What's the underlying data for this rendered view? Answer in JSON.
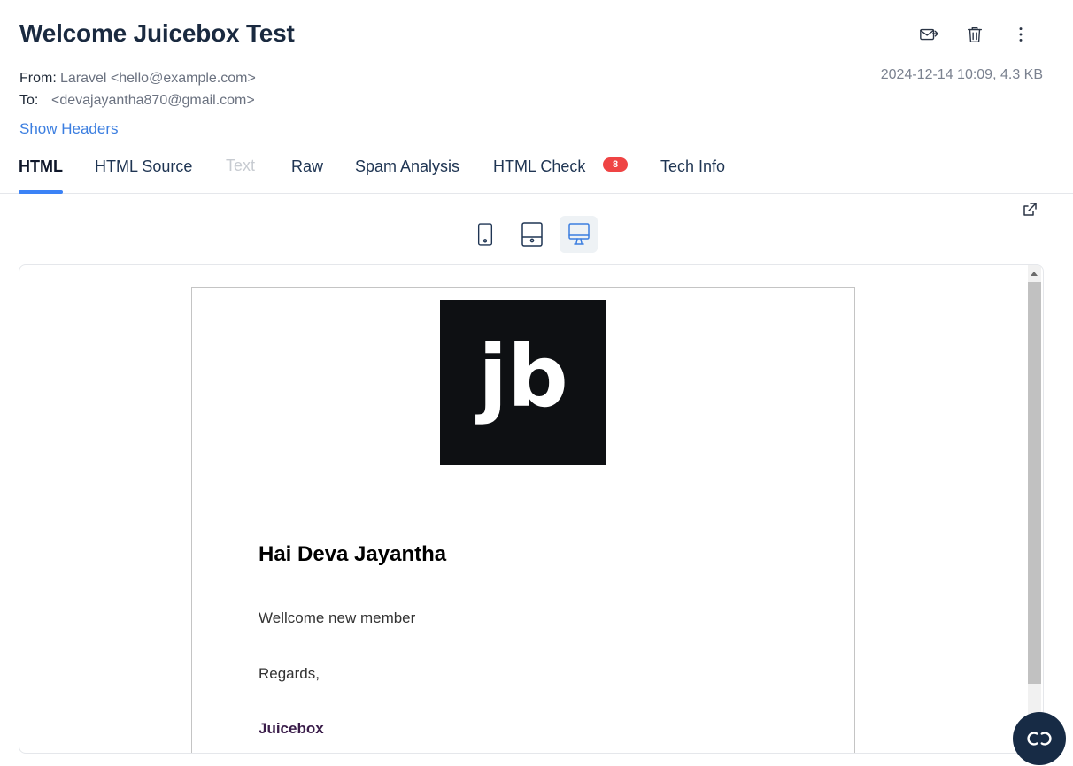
{
  "email": {
    "subject": "Welcome Juicebox Test",
    "from_label": "From:",
    "from_value": "Laravel <hello@example.com>",
    "to_label": "To:",
    "to_value": "<devajayantha870@gmail.com>",
    "date_size": "2024-12-14 10:09, 4.3 KB",
    "show_headers": "Show Headers"
  },
  "actions": {
    "icons": [
      "forward-mail-icon",
      "trash-icon",
      "more-vertical-icon"
    ]
  },
  "tabs": [
    {
      "label": "HTML",
      "state": "active"
    },
    {
      "label": "HTML Source",
      "state": "normal"
    },
    {
      "label": "Text",
      "state": "disabled"
    },
    {
      "label": "Raw",
      "state": "normal"
    },
    {
      "label": "Spam Analysis",
      "state": "normal"
    },
    {
      "label": "HTML Check",
      "state": "normal",
      "badge": "8"
    },
    {
      "label": "Tech Info",
      "state": "normal"
    }
  ],
  "device_switch": {
    "options": [
      "mobile",
      "tablet",
      "desktop"
    ],
    "selected": "desktop"
  },
  "preview": {
    "logo_text": "jb",
    "greeting": "Hai Deva Jayantha",
    "line1": "Wellcome new member",
    "line2": "Regards,",
    "signoff": "Juicebox"
  },
  "colors": {
    "accent": "#3b82f6",
    "badge": "#ef4444",
    "fab": "#172b45",
    "logo_bg": "#0e1013"
  }
}
